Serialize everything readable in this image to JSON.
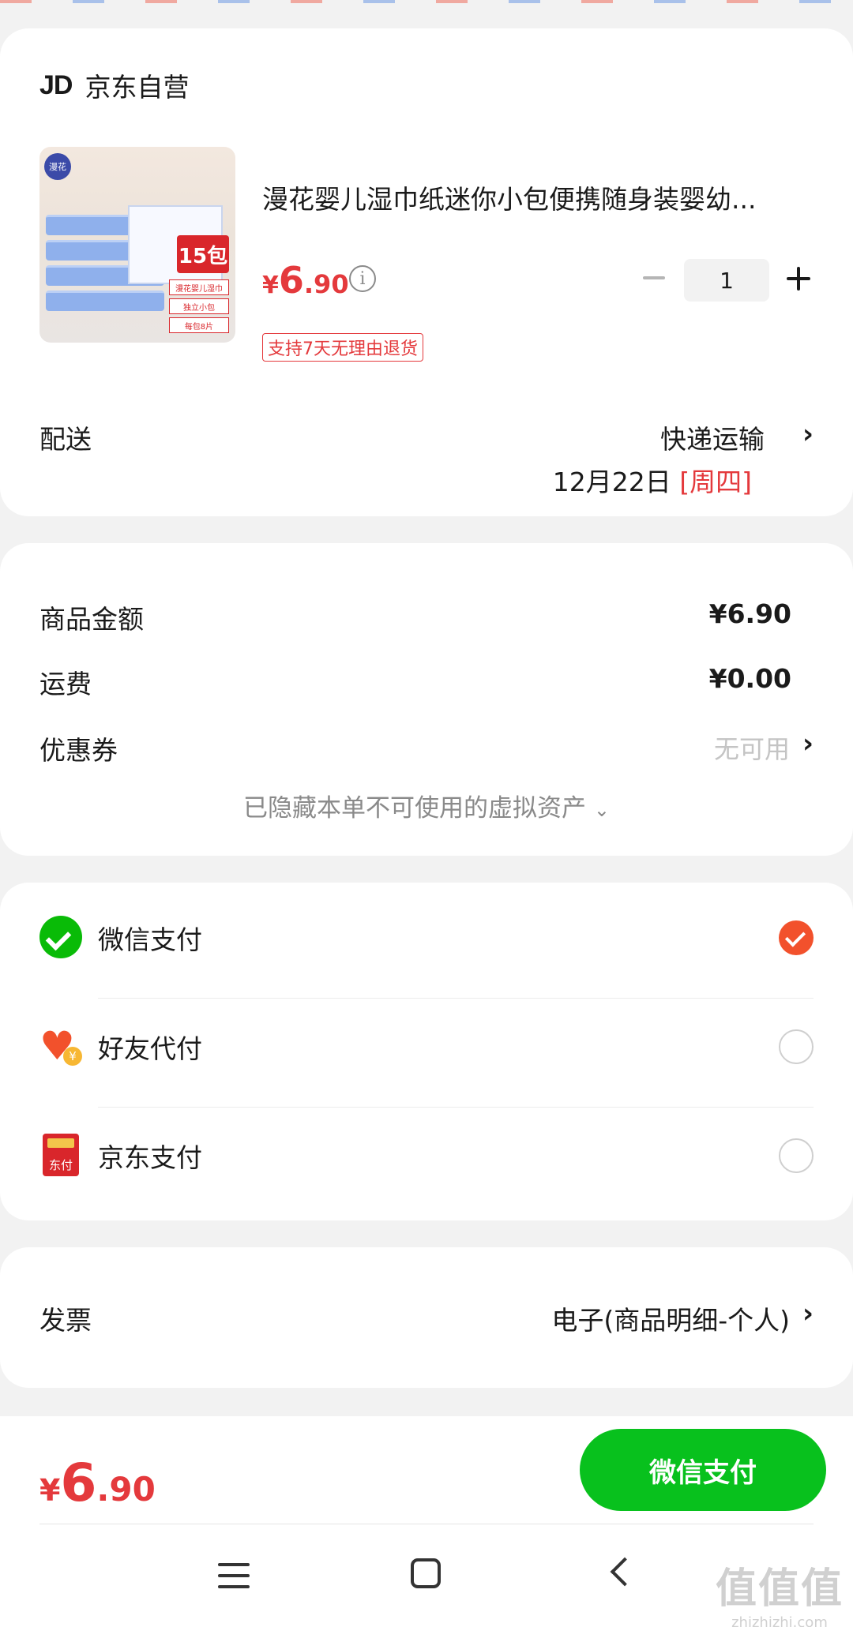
{
  "shop": {
    "logo": "JD",
    "name": "京东自营"
  },
  "product": {
    "title": "漫花婴儿湿巾纸迷你小包便携随身装婴幼...",
    "image": {
      "brand": "漫花",
      "count_badge": "15包",
      "tags": [
        "漫花婴儿湿巾",
        "独立小包",
        "每包8片"
      ]
    },
    "price_currency": "¥",
    "price_integer": "6",
    "price_decimal": ".90",
    "return_tag": "支持7天无理由退货",
    "quantity": "1"
  },
  "delivery": {
    "label": "配送",
    "method": "快递运输",
    "date": "12月22日",
    "weekday": "[周四]"
  },
  "amounts": {
    "goods_label": "商品金额",
    "goods_value": "¥6.90",
    "shipping_label": "运费",
    "shipping_value": "¥0.00",
    "coupon_label": "优惠券",
    "coupon_value": "无可用",
    "hidden_assets": "已隐藏本单不可使用的虚拟资产"
  },
  "payment": {
    "methods": [
      {
        "label": "微信支付",
        "icon": "wechat-pay-icon",
        "selected": true
      },
      {
        "label": "好友代付",
        "icon": "friend-pay-heart-icon",
        "badge": "¥",
        "selected": false
      },
      {
        "label": "京东支付",
        "icon": "jd-pay-icon",
        "badge": "东付",
        "selected": false
      }
    ]
  },
  "invoice": {
    "label": "发票",
    "value": "电子(商品明细-个人)"
  },
  "footer": {
    "total_currency": "¥",
    "total_integer": "6",
    "total_decimal": ".90",
    "pay_button": "微信支付"
  },
  "watermark": {
    "big": "值值值",
    "small": "zhizhizhi.com"
  },
  "colors": {
    "price_red": "#e4393c",
    "pay_green": "#08c11d",
    "check_orange": "#f2512c"
  }
}
